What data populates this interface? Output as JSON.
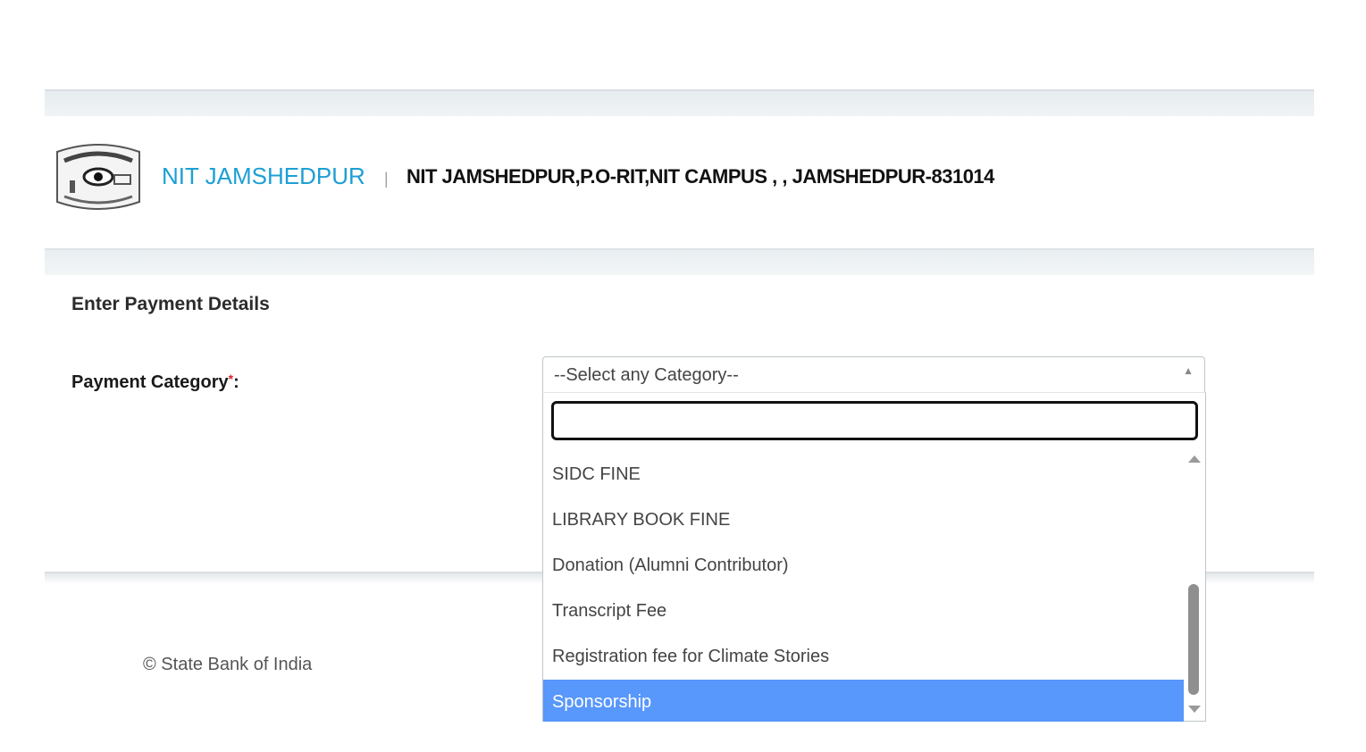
{
  "header": {
    "logo_icon": "institute-emblem-icon",
    "org_name": "NIT JAMSHEDPUR",
    "separator": "|",
    "org_address": "NIT JAMSHEDPUR,P.O-RIT,NIT CAMPUS , , JAMSHEDPUR-831014"
  },
  "form": {
    "section_title": "Enter Payment Details",
    "payment_category": {
      "label": "Payment Category",
      "required_mark": "*",
      "colon": ":",
      "selected_value": "--Select any Category--",
      "search_value": "",
      "options": [
        "SIDC FINE",
        "LIBRARY BOOK FINE",
        "Donation (Alumni Contributor)",
        "Transcript Fee",
        "Registration fee for Climate Stories",
        "Sponsorship"
      ],
      "highlighted_option": "Sponsorship"
    }
  },
  "footer": {
    "copyright": "© State Bank of India"
  },
  "colors": {
    "brand": "#1d9fd4",
    "highlight": "#5897fb",
    "required": "#e0202a"
  }
}
